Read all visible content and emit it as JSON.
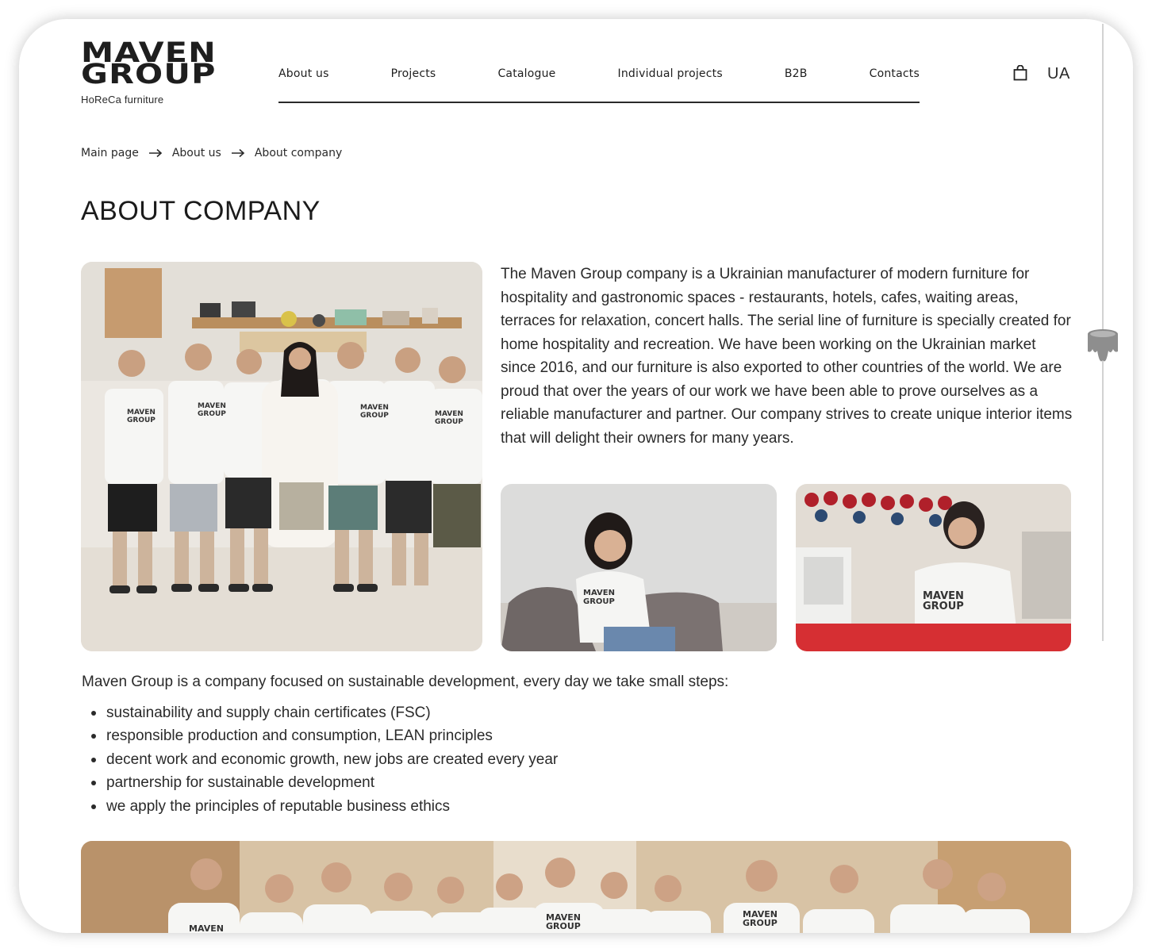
{
  "brand": {
    "name_line1": "MAVEN",
    "name_line2": "GROUP",
    "tagline": "HoReCa furniture"
  },
  "nav": {
    "items": [
      "About us",
      "Projects",
      "Catalogue",
      "Individual projects",
      "B2B",
      "Contacts"
    ]
  },
  "header": {
    "cart_icon": "shopping-bag-icon",
    "language": "UA"
  },
  "breadcrumb": [
    "Main page",
    "About us",
    "About company"
  ],
  "page": {
    "title": "ABOUT COMPANY",
    "intro": "The Maven Group company is a Ukrainian manufacturer of modern furniture for hospitality and gastronomic spaces - restaurants, hotels, cafes, waiting areas, terraces for relaxation, concert halls. The serial line of furniture is specially created for home hospitality and recreation. We have been working on the Ukrainian market since 2016, and our furniture is also exported to other countries of the world. We are proud that over the years of our work we have been able to prove ourselves as a reliable manufacturer and partner. Our company strives to create unique interior items that will delight their owners for many years.",
    "focus": "Maven Group is a company focused on sustainable development, every day we take small steps:",
    "steps": [
      "sustainability and supply chain certificates (FSC)",
      "responsible production and consumption, LEAN principles",
      "decent work and economic growth, new jobs are created every year",
      "partnership for sustainable development",
      "we apply the principles of reputable business ethics"
    ]
  },
  "photos": {
    "shirt_print_line1": "MAVEN",
    "shirt_print_line2": "GROUP"
  },
  "colors": {
    "text": "#1b1b1b",
    "shirt": "#f4f4f2",
    "wood": "#c9a27a",
    "floor": "#e6e1da"
  }
}
